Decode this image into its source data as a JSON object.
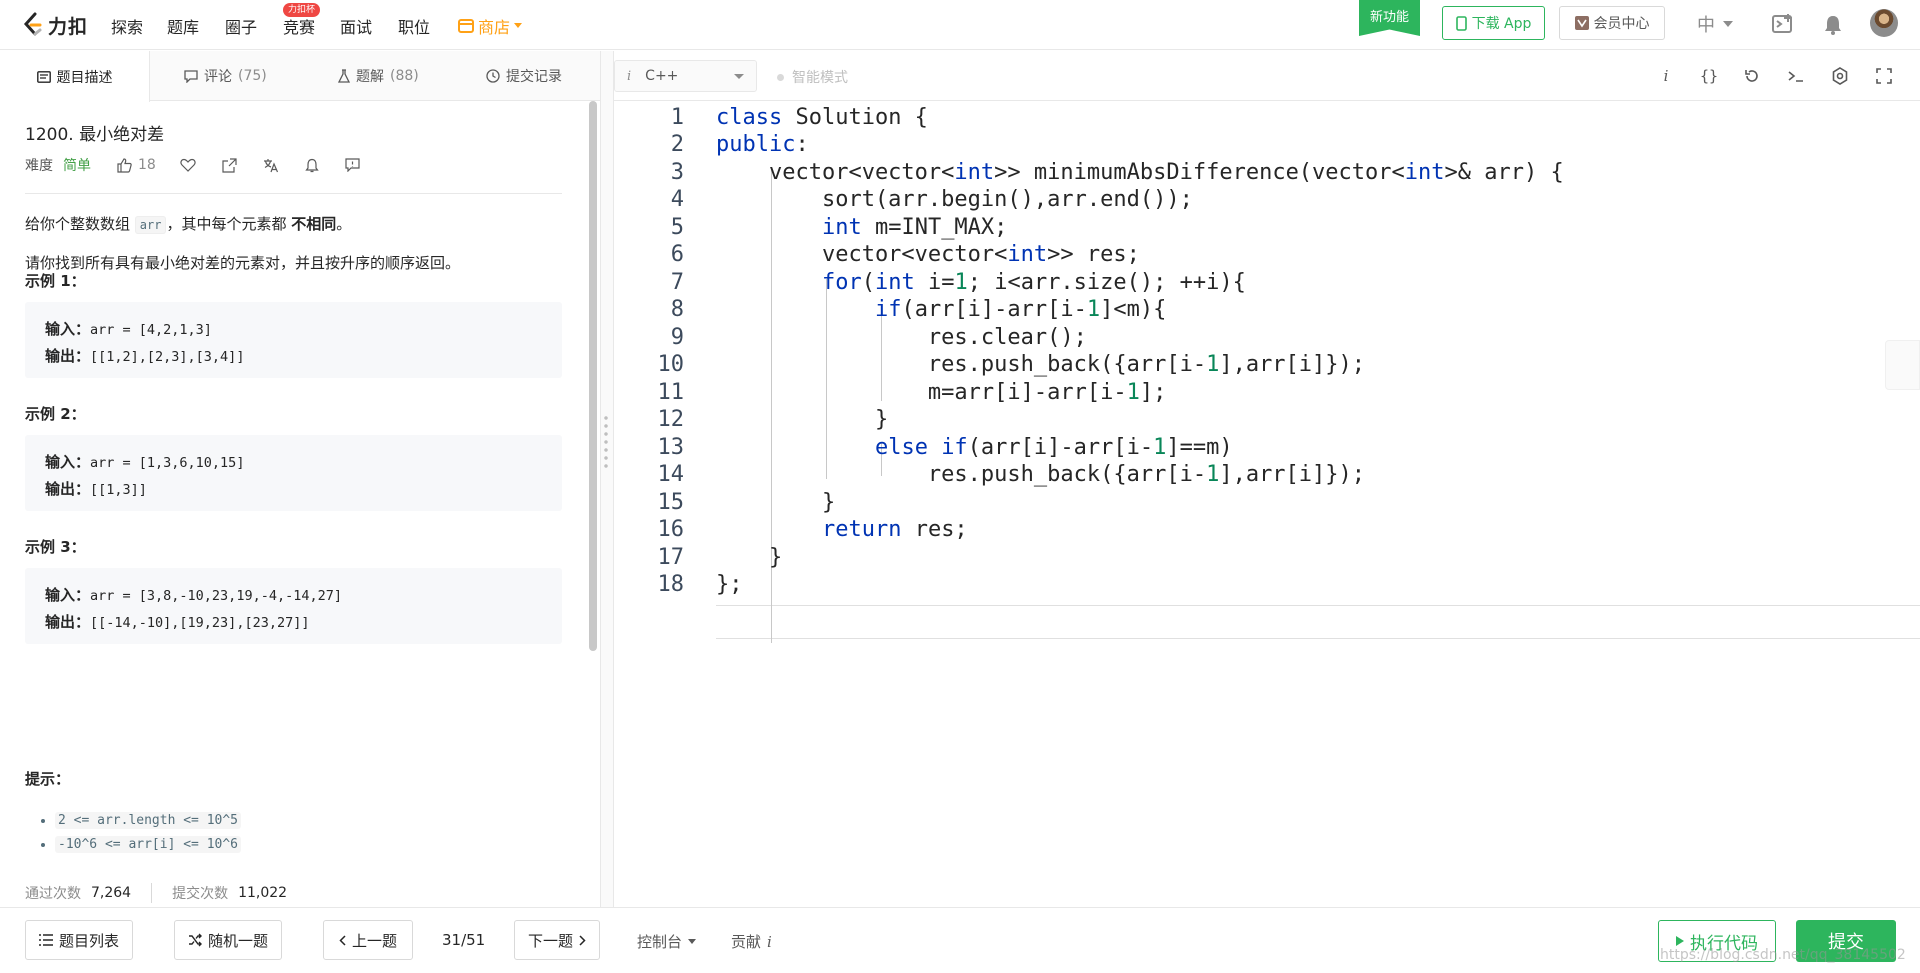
{
  "nav": {
    "logo_text": "力扣",
    "items": [
      "探索",
      "题库",
      "圈子",
      "竞赛",
      "面试",
      "职位"
    ],
    "contest_badge": "力扣杯",
    "store_label": "商店",
    "new_feature": "新功能",
    "download_label": "下载 App",
    "vip_label": "会员中心",
    "lang_label": "中"
  },
  "tabs": {
    "desc": "题目描述",
    "comments": "评论",
    "comments_count": "(75)",
    "solutions": "题解",
    "solutions_count": "(88)",
    "submissions": "提交记录"
  },
  "problem": {
    "title": "1200. 最小绝对差",
    "difficulty_label": "难度",
    "difficulty": "简单",
    "likes": "18",
    "para1_a": "给你个整数数组",
    "para1_code": "arr",
    "para1_b": "，其中每个元素都",
    "para1_bold": "不相同",
    "para1_c": "。",
    "para2": "请你找到所有具有最小绝对差的元素对，并且按升序的顺序返回。",
    "examples": [
      {
        "title": "示例 1：",
        "input_label": "输入：",
        "input": "arr = [4,2,1,3]",
        "output_label": "输出：",
        "output": "[[1,2],[2,3],[3,4]]"
      },
      {
        "title": "示例 2：",
        "input_label": "输入：",
        "input": "arr = [1,3,6,10,15]",
        "output_label": "输出：",
        "output": "[[1,3]]"
      },
      {
        "title": "示例 3：",
        "input_label": "输入：",
        "input": "arr = [3,8,-10,23,19,-4,-14,27]",
        "output_label": "输出：",
        "output": "[[-14,-10],[19,23],[23,27]]"
      }
    ],
    "hints_title": "提示：",
    "hints": [
      "2 <= arr.length <= 10^5",
      "-10^6 <= arr[i] <= 10^6"
    ],
    "accepted_label": "通过次数",
    "accepted": "7,264",
    "submitted_label": "提交次数",
    "submitted": "11,022"
  },
  "editor": {
    "language": "C++",
    "smart_mode": "智能模式",
    "line_numbers": [
      "1",
      "2",
      "3",
      "4",
      "5",
      "6",
      "7",
      "8",
      "9",
      "10",
      "11",
      "12",
      "13",
      "14",
      "15",
      "16",
      "17",
      "18"
    ]
  },
  "bottom": {
    "problem_list": "题目列表",
    "random": "随机一题",
    "prev": "上一题",
    "page": "31/51",
    "next": "下一题",
    "console": "控制台",
    "contribute": "贡献",
    "run": "执行代码",
    "submit": "提交",
    "watermark": "https://blog.csdn.net/qq_38145502"
  },
  "colors": {
    "brand_green": "#2db55d",
    "accent_orange": "#ffa116",
    "easy_green": "#43a047",
    "keyword": "#0033b3",
    "number": "#098658"
  }
}
